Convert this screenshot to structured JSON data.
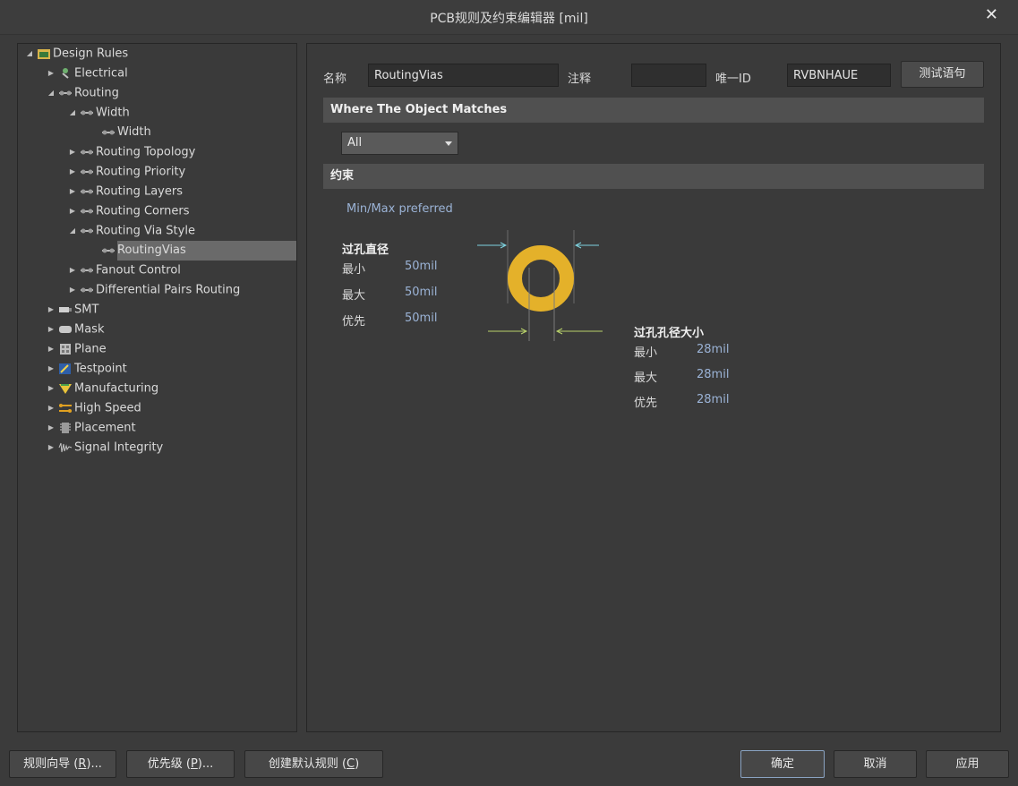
{
  "window": {
    "title": "PCB规则及约束编辑器 [mil]",
    "close": "✕"
  },
  "tree": {
    "root": "Design Rules",
    "electrical": "Electrical",
    "routing": "Routing",
    "width": "Width",
    "width_child": "Width",
    "routing_topology": "Routing Topology",
    "routing_priority": "Routing Priority",
    "routing_layers": "Routing Layers",
    "routing_corners": "Routing Corners",
    "routing_via_style": "Routing Via Style",
    "routing_vias": "RoutingVias",
    "fanout_control": "Fanout Control",
    "diff_pairs": "Differential Pairs Routing",
    "smt": "SMT",
    "mask": "Mask",
    "plane": "Plane",
    "testpoint": "Testpoint",
    "manufacturing": "Manufacturing",
    "high_speed": "High Speed",
    "placement": "Placement",
    "signal_integrity": "Signal Integrity"
  },
  "form": {
    "name_label": "名称",
    "name_value": "RoutingVias",
    "comment_label": "注释",
    "comment_value": "",
    "uid_label": "唯一ID",
    "uid_value": "RVBNHAUE",
    "test_button": "测试语句"
  },
  "where": {
    "header": "Where The Object Matches",
    "scope": "All"
  },
  "constraints": {
    "header": "约束",
    "mode": "Min/Max preferred",
    "diameter": {
      "title": "过孔直径",
      "min_label": "最小",
      "min": "50mil",
      "max_label": "最大",
      "max": "50mil",
      "pref_label": "优先",
      "pref": "50mil"
    },
    "hole": {
      "title": "过孔孔径大小",
      "min_label": "最小",
      "min": "28mil",
      "max_label": "最大",
      "max": "28mil",
      "pref_label": "优先",
      "pref": "28mil"
    }
  },
  "footer": {
    "wizard_pre": "规则向导 (",
    "wizard_key": "R",
    "wizard_post": ")...",
    "priority_pre": "优先级 (",
    "priority_key": "P",
    "priority_post": ")...",
    "default_pre": "创建默认规则 (",
    "default_key": "C",
    "default_post": ")",
    "ok": "确定",
    "cancel": "取消",
    "apply": "应用"
  },
  "colors": {
    "via_ring": "#e4b12a",
    "accent_blue": "#9bb3d6",
    "diameter_arrow": "#7fd3e0",
    "hole_arrow": "#b9d36b"
  }
}
